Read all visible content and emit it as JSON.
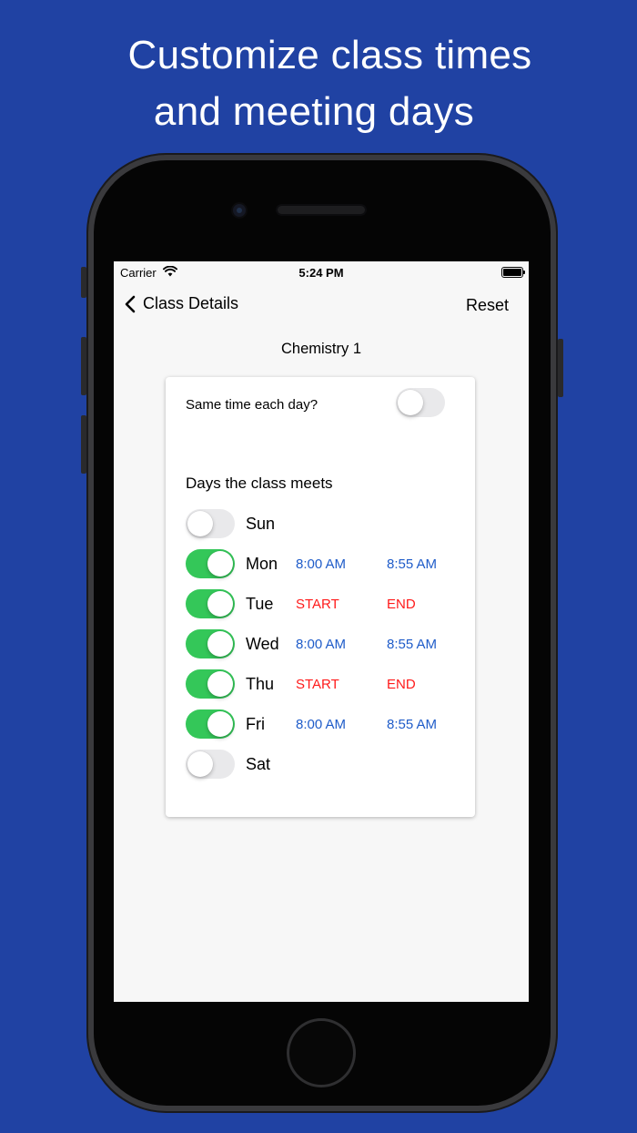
{
  "headline": {
    "line1": "Customize class times",
    "line2": "and meeting days"
  },
  "status_bar": {
    "carrier": "Carrier",
    "time": "5:24 PM",
    "wifi_icon": "wifi-icon",
    "battery_icon": "battery-icon"
  },
  "nav": {
    "back_label": "Class Details",
    "reset_label": "Reset"
  },
  "class_name": "Chemistry 1",
  "card": {
    "same_time_label": "Same time each day?",
    "same_time_on": false,
    "days_heading": "Days the class meets",
    "days": [
      {
        "name": "Sun",
        "on": false,
        "start": "",
        "end": ""
      },
      {
        "name": "Mon",
        "on": true,
        "start": "8:00 AM",
        "end": "8:55 AM"
      },
      {
        "name": "Tue",
        "on": true,
        "start": "START",
        "end": "END"
      },
      {
        "name": "Wed",
        "on": true,
        "start": "8:00 AM",
        "end": "8:55 AM"
      },
      {
        "name": "Thu",
        "on": true,
        "start": "START",
        "end": "END"
      },
      {
        "name": "Fri",
        "on": true,
        "start": "8:00 AM",
        "end": "8:55 AM"
      },
      {
        "name": "Sat",
        "on": false,
        "start": "",
        "end": ""
      }
    ]
  },
  "colors": {
    "background": "#2042a3",
    "toggle_on": "#34c759",
    "time_set": "#1f5cc9",
    "time_unset": "#ff1a1a"
  }
}
